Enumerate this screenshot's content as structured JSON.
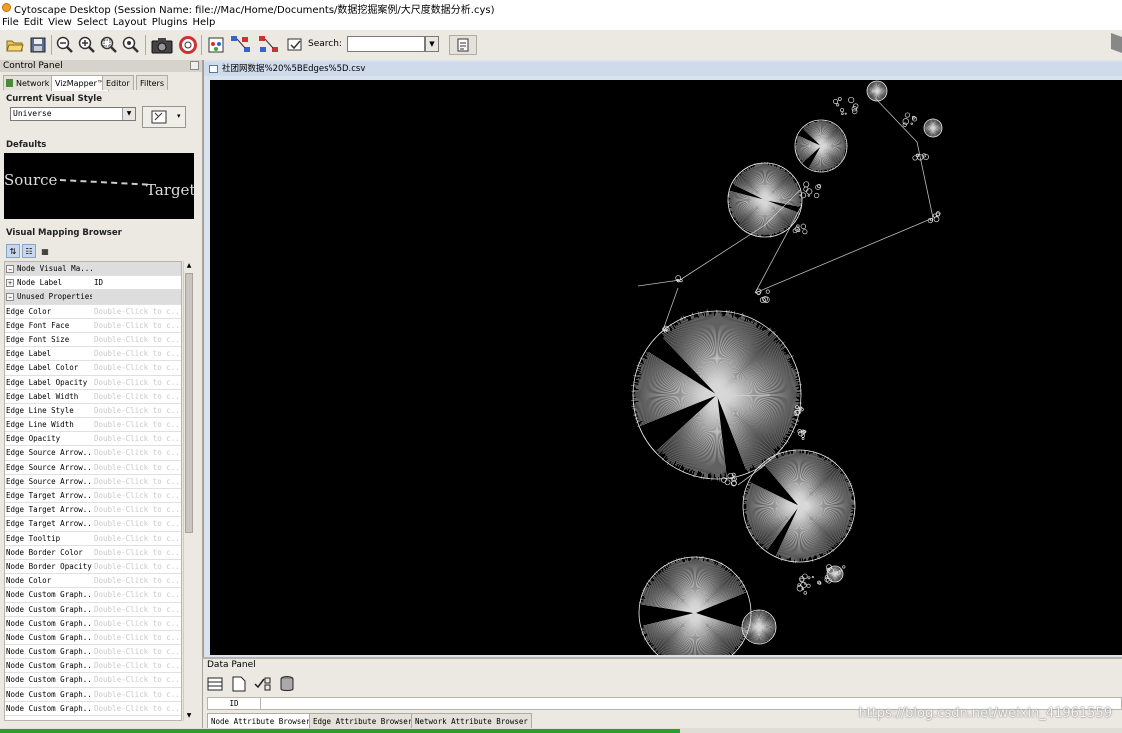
{
  "window": {
    "title": "Cytoscape Desktop (Session Name: file://Mac/Home/Documents/数据挖掘案例/大尺度数据分析.cys)"
  },
  "menu": [
    "File",
    "Edit",
    "View",
    "Select",
    "Layout",
    "Plugins",
    "Help"
  ],
  "toolbar": {
    "search_label": "Search:",
    "search_value": ""
  },
  "control_panel": {
    "title": "Control Panel",
    "tabs": [
      "Network",
      "VizMapper™",
      "Editor",
      "Filters"
    ],
    "active_tab": "VizMapper™",
    "current_visual_style_label": "Current Visual Style",
    "current_visual_style": "Universe",
    "defaults_label": "Defaults",
    "defaults_source": "Source",
    "defaults_target": "Target",
    "mapping_browser_label": "Visual Mapping Browser",
    "sections": [
      {
        "label": "Node Visual Ma...",
        "value": ""
      },
      {
        "label": "Node Label",
        "value": "ID"
      },
      {
        "label": "Unused Properties",
        "value": ""
      }
    ],
    "placeholder_value": "Double-Click to c...",
    "unused_properties": [
      "Edge Color",
      "Edge Font Face",
      "Edge Font Size",
      "Edge Label",
      "Edge Label Color",
      "Edge Label Opacity",
      "Edge Label Width",
      "Edge Line Style",
      "Edge Line Width",
      "Edge Opacity",
      "Edge Source Arrow...",
      "Edge Source Arrow...",
      "Edge Source Arrow...",
      "Edge Target Arrow...",
      "Edge Target Arrow...",
      "Edge Target Arrow...",
      "Edge Tooltip",
      "Node Border Color",
      "Node Border Opacity",
      "Node Color",
      "Node Custom Graph...",
      "Node Custom Graph...",
      "Node Custom Graph...",
      "Node Custom Graph...",
      "Node Custom Graph...",
      "Node Custom Graph...",
      "Node Custom Graph...",
      "Node Custom Graph...",
      "Node Custom Graph..."
    ]
  },
  "network_view": {
    "title": "社团网数据%20%5BEdges%5D.csv"
  },
  "data_panel": {
    "title": "Data Panel",
    "column": "ID",
    "tabs": [
      "Node Attribute Browser",
      "Edge Attribute Browser",
      "Network Attribute Browser"
    ],
    "watermark": "https://blog.csdn.net/weixin_41961559"
  }
}
